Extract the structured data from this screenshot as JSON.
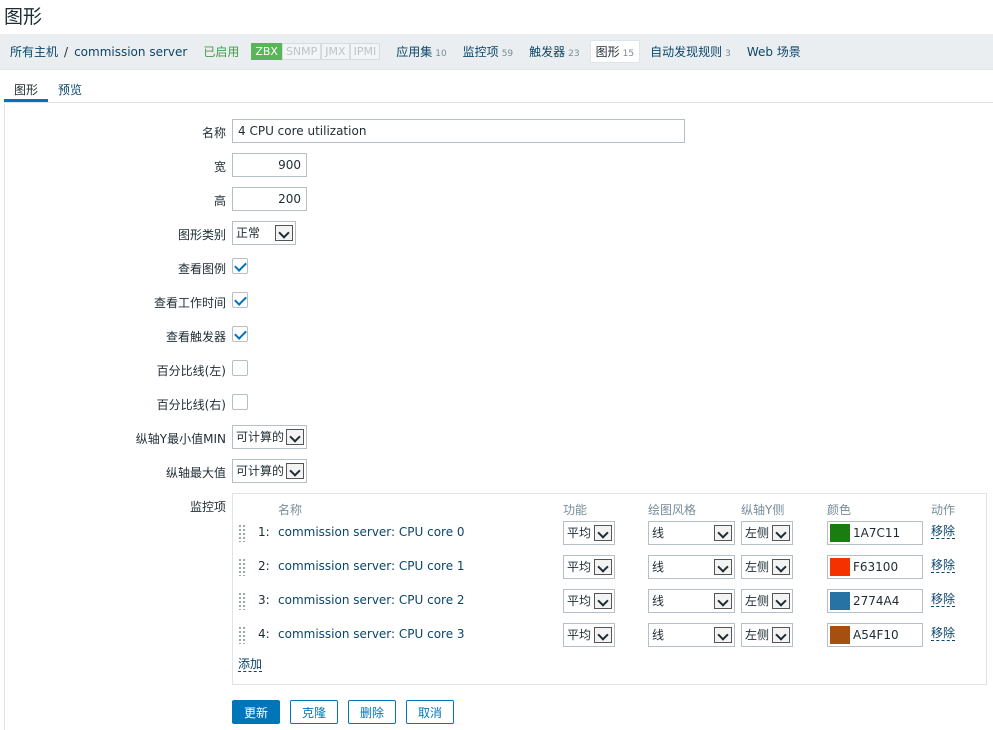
{
  "page": {
    "title": "图形"
  },
  "breadcrumb": {
    "all_hosts": "所有主机",
    "separator": "/",
    "host": "commission server"
  },
  "host_status": "已启用",
  "availability_tags": [
    {
      "label": "ZBX",
      "state": "available"
    },
    {
      "label": "SNMP",
      "state": "unknown"
    },
    {
      "label": "JMX",
      "state": "unknown"
    },
    {
      "label": "IPMI",
      "state": "unknown"
    }
  ],
  "host_nav": [
    {
      "label": "应用集",
      "count": "10"
    },
    {
      "label": "监控项",
      "count": "59"
    },
    {
      "label": "触发器",
      "count": "23"
    },
    {
      "label": "图形",
      "count": "15"
    },
    {
      "label": "自动发现规则",
      "count": "3"
    },
    {
      "label": "Web 场景",
      "count": ""
    }
  ],
  "tabs": [
    "图形",
    "预览"
  ],
  "form": {
    "name_label": "名称",
    "name_value": "4 CPU core utilization",
    "width_label": "宽",
    "width_value": "900",
    "height_label": "高",
    "height_value": "200",
    "graph_type_label": "图形类别",
    "graph_type_value": "正常",
    "show_legend_label": "查看图例",
    "show_legend": true,
    "show_work_period_label": "查看工作时间",
    "show_work_period": true,
    "show_triggers_label": "查看触发器",
    "show_triggers": true,
    "percentile_left_label": "百分比线(左)",
    "percentile_left": false,
    "percentile_right_label": "百分比线(右)",
    "percentile_right": false,
    "ymin_label": "纵轴Y最小值MIN",
    "ymin_value": "可计算的",
    "ymax_label": "纵轴最大值",
    "ymax_value": "可计算的",
    "items_label": "监控项"
  },
  "items_table": {
    "headers": {
      "name": "名称",
      "function": "功能",
      "draw_style": "绘图风格",
      "y_axis_side": "纵轴Y侧",
      "color": "颜色",
      "action": "动作"
    },
    "rows": [
      {
        "num": "1:",
        "name": "commission server: CPU core 0",
        "function": "平均",
        "draw_style": "线",
        "y_side": "左侧",
        "color": "1A7C11",
        "color_hex": "#1A7C11",
        "action": "移除"
      },
      {
        "num": "2:",
        "name": "commission server: CPU core 1",
        "function": "平均",
        "draw_style": "线",
        "y_side": "左侧",
        "color": "F63100",
        "color_hex": "#F63100",
        "action": "移除"
      },
      {
        "num": "3:",
        "name": "commission server: CPU core 2",
        "function": "平均",
        "draw_style": "线",
        "y_side": "左侧",
        "color": "2774A4",
        "color_hex": "#2774A4",
        "action": "移除"
      },
      {
        "num": "4:",
        "name": "commission server: CPU core 3",
        "function": "平均",
        "draw_style": "线",
        "y_side": "左侧",
        "color": "A54F10",
        "color_hex": "#A54F10",
        "action": "移除"
      }
    ],
    "add_label": "添加"
  },
  "buttons": {
    "update": "更新",
    "clone": "克隆",
    "delete": "删除",
    "cancel": "取消"
  }
}
